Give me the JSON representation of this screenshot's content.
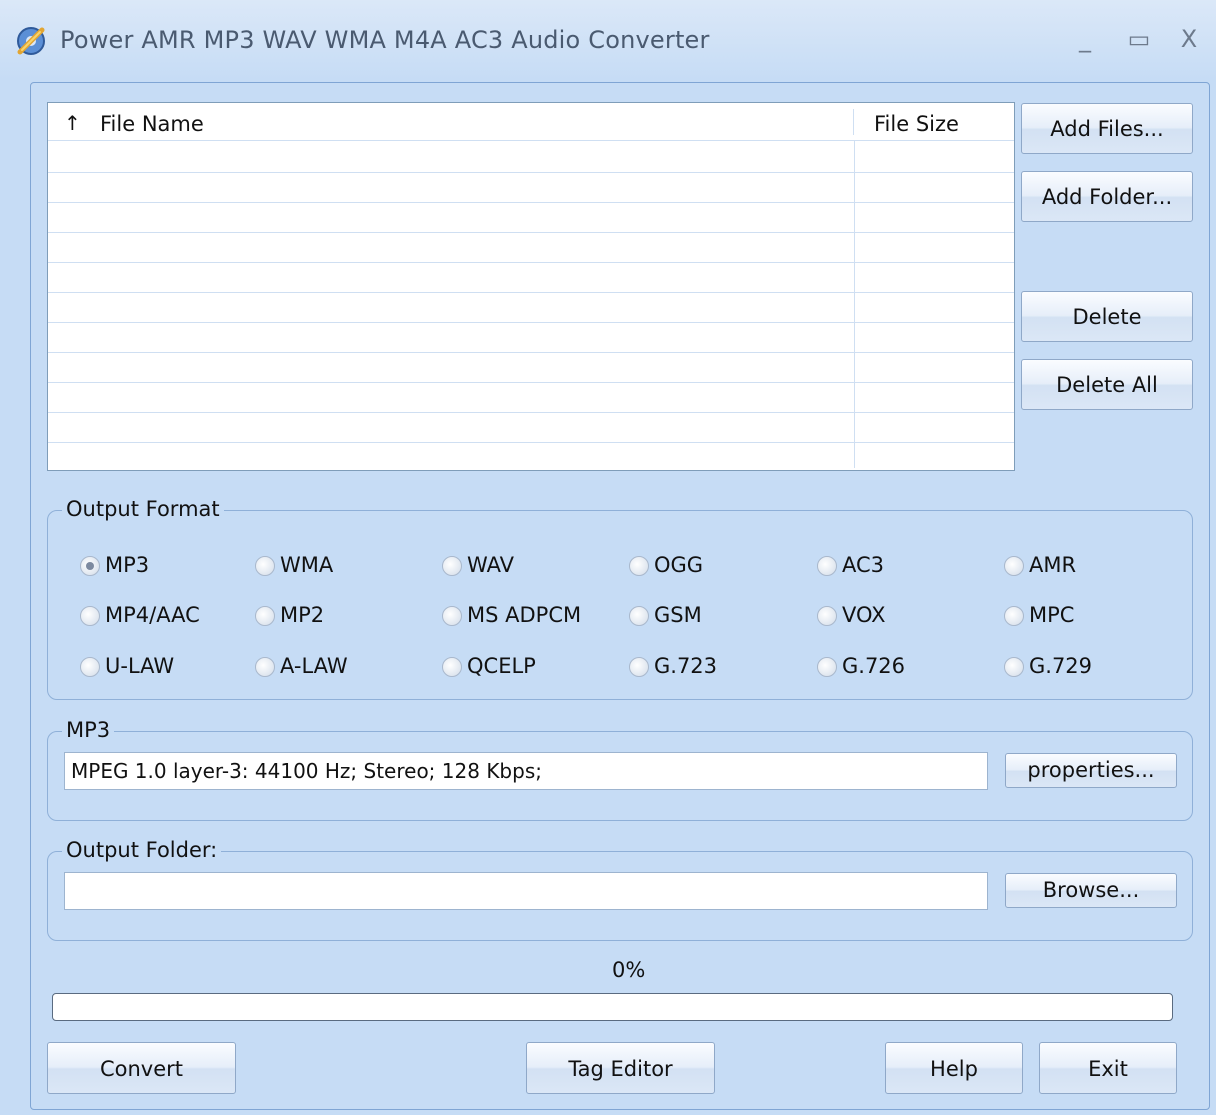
{
  "window": {
    "title": "Power AMR MP3 WAV WMA M4A AC3 Audio Converter",
    "minimize_glyph": "_",
    "maximize_glyph": "▭",
    "close_glyph": "X"
  },
  "file_list": {
    "sort_indicator": "↑",
    "columns": [
      "File Name",
      "File Size"
    ],
    "rows": []
  },
  "side_buttons": {
    "add_files": "Add Files...",
    "add_folder": "Add Folder...",
    "delete": "Delete",
    "delete_all": "Delete All"
  },
  "output_format": {
    "title": "Output Format",
    "selected": "MP3",
    "options": [
      [
        "MP3",
        "WMA",
        "WAV",
        "OGG",
        "AC3",
        "AMR"
      ],
      [
        "MP4/AAC",
        "MP2",
        "MS ADPCM",
        "GSM",
        "VOX",
        "MPC"
      ],
      [
        "U-LAW",
        "A-LAW",
        "QCELP",
        "G.723",
        "G.726",
        "G.729"
      ]
    ]
  },
  "format_settings": {
    "title": "MP3",
    "value": "MPEG 1.0 layer-3: 44100 Hz; Stereo;  128 Kbps;",
    "properties_label": "properties..."
  },
  "output_folder": {
    "title": "Output Folder:",
    "value": "",
    "browse_label": "Browse..."
  },
  "progress": {
    "label": "0%",
    "value": 0
  },
  "bottom_buttons": {
    "convert": "Convert",
    "tag_editor": "Tag Editor",
    "help": "Help",
    "exit": "Exit"
  },
  "colors": {
    "background": "#c6dcf5",
    "border": "#8fb0d8"
  }
}
